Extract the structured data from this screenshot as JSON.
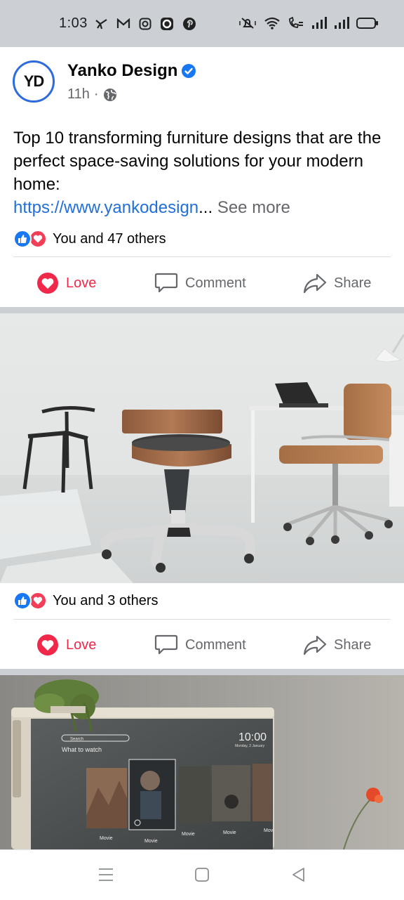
{
  "status_bar": {
    "time": "1:03",
    "left_icons": [
      "twitter-bird-icon",
      "gmail-icon",
      "instagram-icon",
      "opera-icon",
      "pinterest-icon"
    ],
    "right_icons": [
      "mute-icon",
      "wifi-icon",
      "volte-call-icon",
      "signal-icon",
      "signal-icon",
      "battery-icon"
    ]
  },
  "post": {
    "page_name": "Yanko Design",
    "avatar_initials": "YD",
    "time_ago": "11h",
    "audience_icon": "globe-icon",
    "text": "Top 10 transforming furniture designs that are the perfect space-saving solutions for your modern home:",
    "link_text": "https://www.yankodesign",
    "ellipsis": "...",
    "see_more": "See more",
    "reactions_summary": "You and 47 others",
    "actions": {
      "love": "Love",
      "comment": "Comment",
      "share": "Share"
    }
  },
  "photo_post_1": {
    "image": "photo-transforming-stool-chair-office",
    "reactions_summary": "You and 3 others",
    "actions": {
      "love": "Love",
      "comment": "Comment",
      "share": "Share"
    }
  },
  "photo_post_2": {
    "image": "photo-smart-tv-cabinet-with-plant",
    "tv_screen": {
      "search_placeholder": "Search",
      "heading": "What to watch",
      "clock": "10:00",
      "date": "Monday, 2 January",
      "tiles": [
        "Movie",
        "Movie",
        "Movie",
        "Movie",
        "Mov"
      ]
    }
  },
  "nav_bar": {
    "buttons": [
      "menu-icon",
      "home-square-icon",
      "back-triangle-icon"
    ]
  },
  "colors": {
    "brand_blue": "#1877f2",
    "love_red": "#f0284a",
    "link_blue": "#216fdb",
    "muted_text": "#65676b",
    "separator_gray": "#ccd0d5"
  }
}
